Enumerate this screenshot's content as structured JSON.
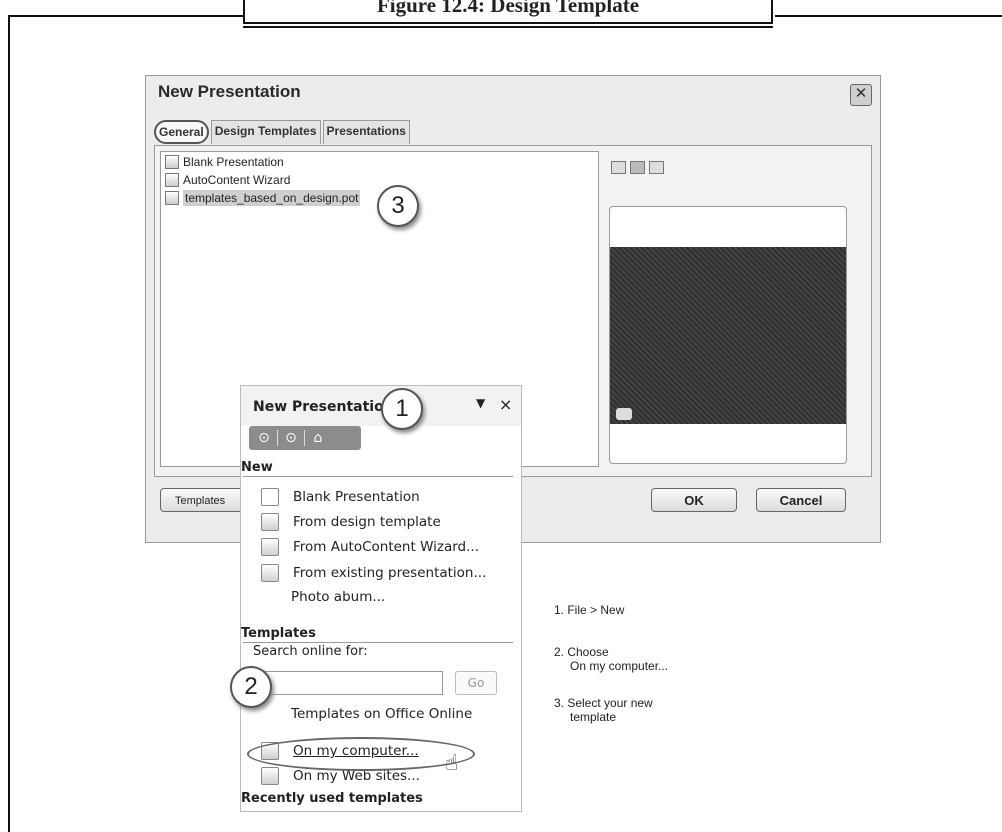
{
  "figure_caption": "Figure 12.4: Design Template",
  "dialog": {
    "title": "New Presentation",
    "close_glyph": "✕",
    "tabs": [
      "General",
      "Design Templates",
      "Presentations"
    ],
    "files": [
      "Blank Presentation",
      "AutoContent Wizard",
      "templates_based_on_design.pot"
    ],
    "buttons": {
      "templates": "Templates",
      "ok": "OK",
      "cancel": "Cancel"
    }
  },
  "callouts": [
    "1",
    "2",
    "3"
  ],
  "task_pane": {
    "title": "New Presentation",
    "dropdown_glyph": "▼",
    "close_glyph": "×",
    "nav": {
      "back_glyph": "⊙",
      "forward_glyph": "⊙",
      "home_glyph": "⌂"
    },
    "new_section": {
      "heading": "New",
      "items": [
        "Blank Presentation",
        "From design template",
        "From AutoContent Wizard...",
        "From existing presentation...",
        "Photo abum..."
      ]
    },
    "templates_section": {
      "heading": "Templates",
      "search_label": "Search online for:",
      "search_value": "",
      "go_label": "Go",
      "items": [
        "Templates on Office Online",
        "On my computer...",
        "On my Web sites..."
      ]
    },
    "recent_heading": "Recently used templates"
  },
  "instructions": {
    "step1": "1.  File  >  New",
    "step2_line1": "2.  Choose",
    "step2_line2": "On my computer...",
    "step3_line1": "3.  Select your new",
    "step3_line2": "template"
  }
}
